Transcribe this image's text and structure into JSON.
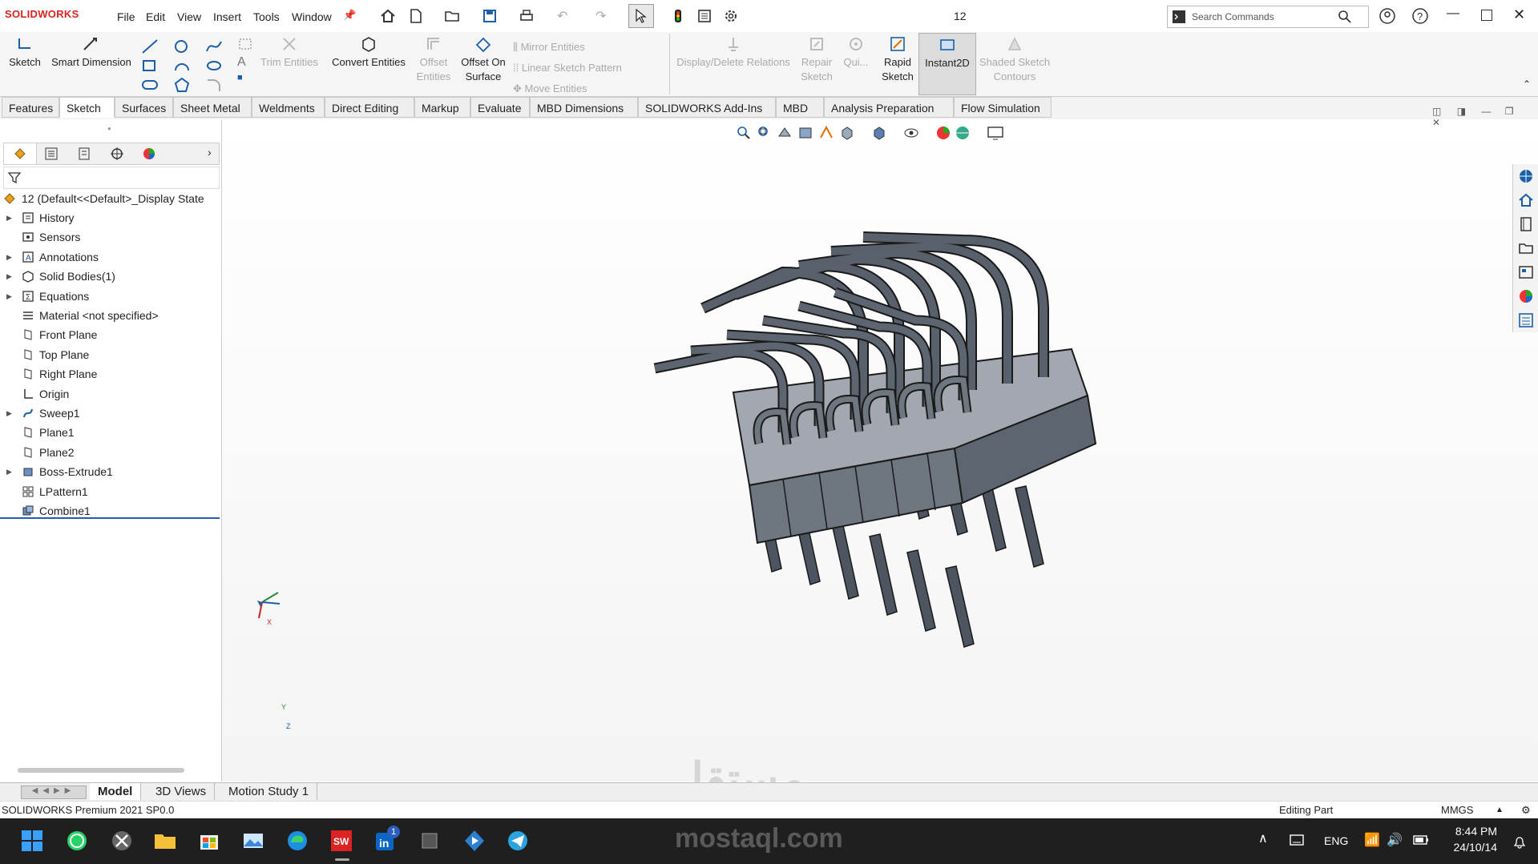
{
  "app": {
    "logo": "SOLIDWORKS",
    "doc_title": "12",
    "menu": [
      "File",
      "Edit",
      "View",
      "Insert",
      "Tools",
      "Window"
    ],
    "search_placeholder": "Search Commands"
  },
  "ribbon": {
    "sketch": "Sketch",
    "smart_dimension": "Smart Dimension",
    "trim_entities": "Trim Entities",
    "convert_entities": "Convert Entities",
    "offset_entities": "Offset Entities",
    "offset_on_surface": "Offset On Surface",
    "mirror_entities": "Mirror Entities",
    "linear_sketch_pattern": "Linear Sketch Pattern",
    "move_entities": "Move Entities",
    "display_delete_relations": "Display/Delete Relations",
    "repair_sketch": "Repair Sketch",
    "quick_snaps": "Qui...",
    "rapid_sketch": "Rapid Sketch",
    "instant2d": "Instant2D",
    "shaded_sketch_contours": "Shaded Sketch Contours"
  },
  "tabs": [
    "Features",
    "Sketch",
    "Surfaces",
    "Sheet Metal",
    "Weldments",
    "Direct Editing",
    "Markup",
    "Evaluate",
    "MBD Dimensions",
    "SOLIDWORKS Add-Ins",
    "MBD",
    "Analysis Preparation",
    "Flow Simulation"
  ],
  "active_tab": "Sketch",
  "tree": {
    "root": "12  (Default<<Default>_Display State",
    "items": [
      {
        "label": "History",
        "expand": true
      },
      {
        "label": "Sensors",
        "expand": false
      },
      {
        "label": "Annotations",
        "expand": true
      },
      {
        "label": "Solid Bodies(1)",
        "expand": true
      },
      {
        "label": "Equations",
        "expand": true
      },
      {
        "label": "Material <not specified>",
        "expand": false
      },
      {
        "label": "Front Plane",
        "expand": false
      },
      {
        "label": "Top Plane",
        "expand": false
      },
      {
        "label": "Right Plane",
        "expand": false
      },
      {
        "label": "Origin",
        "expand": false
      },
      {
        "label": "Sweep1",
        "expand": true
      },
      {
        "label": "Plane1",
        "expand": false
      },
      {
        "label": "Plane2",
        "expand": false
      },
      {
        "label": "Boss-Extrude1",
        "expand": true
      },
      {
        "label": "LPattern1",
        "expand": false
      },
      {
        "label": "Combine1",
        "expand": false
      }
    ]
  },
  "triad": {
    "x": "X",
    "y": "Y",
    "z": "Z"
  },
  "bottom_tabs": [
    "Model",
    "3D Views",
    "Motion Study 1"
  ],
  "status": {
    "version": "SOLIDWORKS Premium 2021 SP0.0",
    "mode": "Editing Part",
    "units": "MMGS"
  },
  "taskbar": {
    "lang": "ENG",
    "time": "8:44 PM",
    "date": "24/10/14",
    "linkedin_badge": "1"
  },
  "watermark": {
    "arabic": "مستقل",
    "latin": "mostaql.com"
  }
}
